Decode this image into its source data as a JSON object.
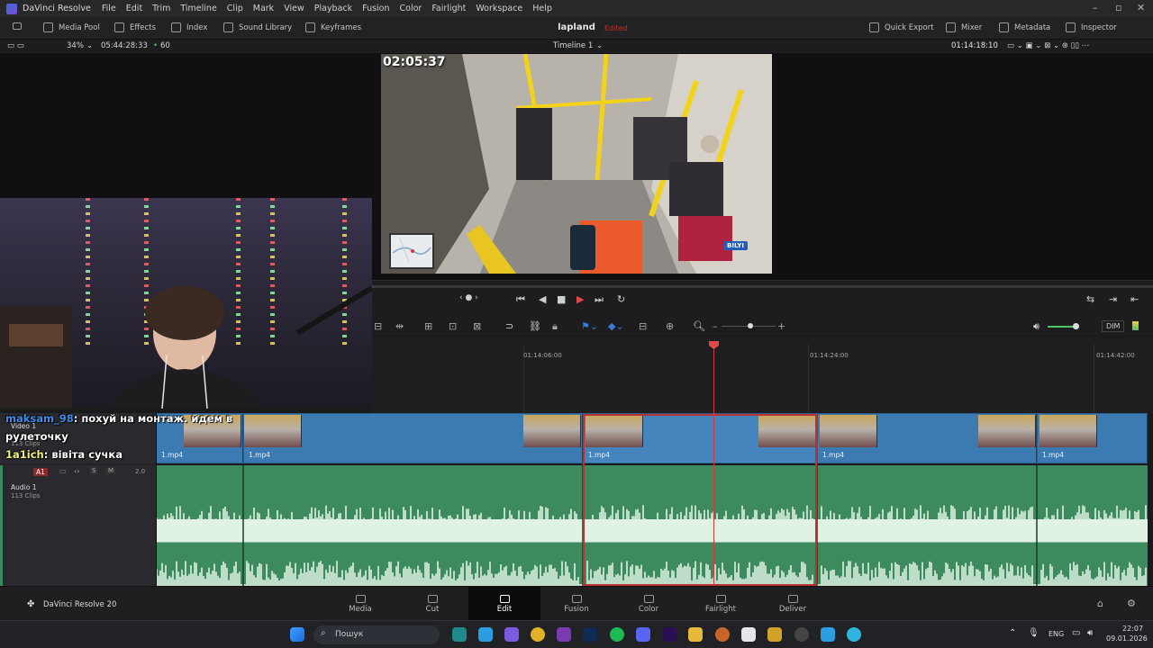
{
  "window": {
    "app_name": "DaVinci Resolve",
    "menus": [
      "File",
      "Edit",
      "Trim",
      "Timeline",
      "Clip",
      "Mark",
      "View",
      "Playback",
      "Fusion",
      "Color",
      "Fairlight",
      "Workspace",
      "Help"
    ]
  },
  "toolbar": {
    "media_pool": "Media Pool",
    "effects": "Effects",
    "index": "Index",
    "sound_library": "Sound Library",
    "keyframes": "Keyframes",
    "project_name": "lapland",
    "project_status": "Edited",
    "quick_export": "Quick Export",
    "mixer": "Mixer",
    "metadata": "Metadata",
    "inspector": "Inspector"
  },
  "viewer": {
    "zoom": "34%",
    "source_timecode": "05:44:28:33",
    "fps": "60",
    "timeline_name": "Timeline 1",
    "record_timecode": "01:14:18:10",
    "burned_in_timecode": "02:05:37",
    "badge": "BILYI"
  },
  "edit_tools": {
    "dim": "DIM"
  },
  "timeline": {
    "ruler": [
      "01:14:06:00",
      "01:14:24:00",
      "01:14:42:00"
    ],
    "video_track": {
      "name": "Video 1",
      "clips_count": "113 Clips",
      "clips": [
        "1.mp4",
        "1.mp4",
        "1.mp4",
        "1.mp4",
        "1.mp4"
      ]
    },
    "audio_track": {
      "id": "A1",
      "name": "Audio 1",
      "clips_count": "113 Clips",
      "level": "2.0",
      "solo": "S",
      "mute": "M"
    }
  },
  "chat": [
    {
      "user": "maksam_98",
      "text": ": похуй на монтаж. йдем в"
    },
    {
      "user": "",
      "text": "рулеточку"
    },
    {
      "user": "1a1ich",
      "text": ": вівіта сучка"
    }
  ],
  "pages": {
    "brand": "DaVinci Resolve 20",
    "items": [
      "Media",
      "Cut",
      "Edit",
      "Fusion",
      "Color",
      "Fairlight",
      "Deliver"
    ],
    "active": "Edit"
  },
  "taskbar": {
    "search": "Пошук",
    "language": "ENG",
    "time": "22:07",
    "date": "09.01.2026"
  },
  "colors": {
    "video_track": "#3c7bb2",
    "audio_track": "#3c8a5e",
    "playhead": "#d23b3b",
    "status_edited": "#c9302c"
  }
}
